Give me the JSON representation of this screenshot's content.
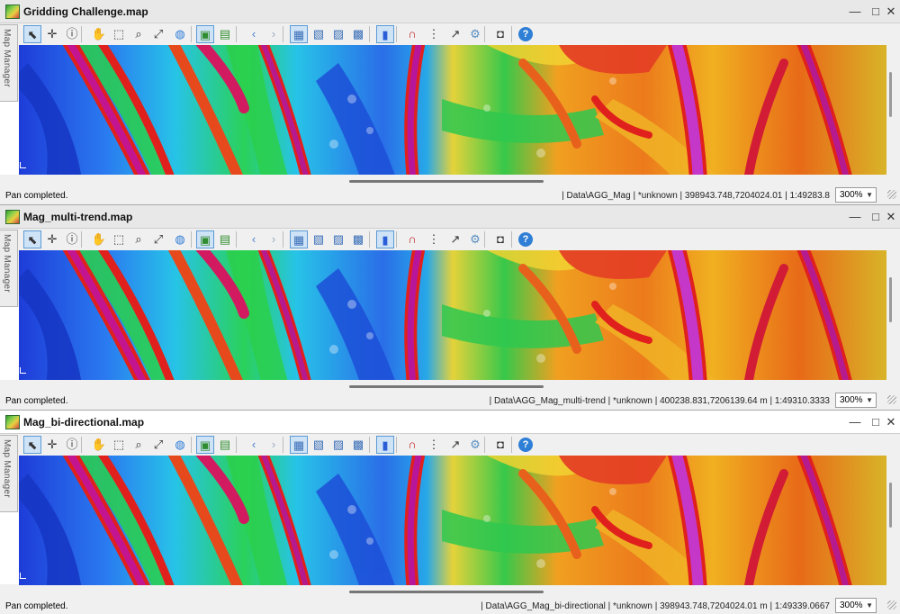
{
  "toolbar_icons": [
    "select-arrow-icon",
    "crosshair-icon",
    "info-icon",
    "pan-hand-icon",
    "zoom-box-icon",
    "zoom-icon",
    "zoom-extent-icon",
    "globe-icon",
    "layer-map-icon",
    "layer-map-alt-icon",
    "back-arrow-icon",
    "forward-arrow-icon",
    "view-1-icon",
    "view-2-icon",
    "view-3-icon",
    "view-4-icon",
    "color-stack-icon",
    "magnet-icon",
    "grid-dots-icon",
    "edit-pointer-icon",
    "gear-icon",
    "camera-icon",
    "help-icon"
  ],
  "map_manager_label": "Map Manager",
  "colors": {
    "active_tool": "#5b9bd5",
    "map_base": "#23c34a"
  },
  "windows": [
    {
      "title": "Gridding Challenge.map",
      "status_message": "Pan completed.",
      "status_info": "| Data\\AGG_Mag  | *unknown  | 398943.748,7204024.01  | 1:49283.8",
      "zoom": "300%",
      "active": false
    },
    {
      "title": "Mag_multi-trend.map",
      "status_message": "Pan completed.",
      "status_info": "| Data\\AGG_Mag_multi-trend  | *unknown  | 400238.831,7206139.64 m  | 1:49310.3333",
      "zoom": "300%",
      "active": false
    },
    {
      "title": "Mag_bi-directional.map",
      "status_message": "Pan completed.",
      "status_info": "| Data\\AGG_Mag_bi-directional  | *unknown  | 398943.748,7204024.01 m  | 1:49339.0667",
      "zoom": "300%",
      "active": true
    }
  ]
}
